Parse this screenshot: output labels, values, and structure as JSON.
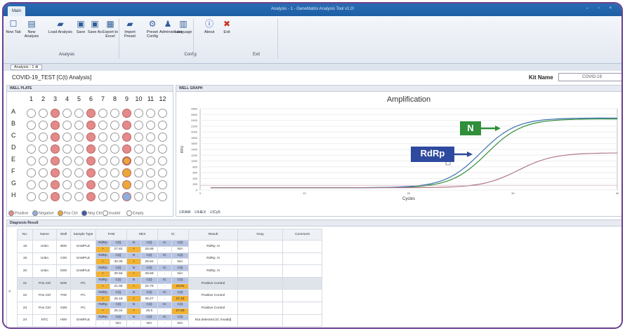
{
  "titlebar": {
    "tab": "Main",
    "title": "Analysis - 1 - GeneMatrix Analysis Tool v1.0!",
    "window_controls": "– ▫ ×"
  },
  "ribbon": {
    "buttons": [
      {
        "label": "New Tab",
        "icon": "new-tab-icon"
      },
      {
        "label": "New Analysis",
        "icon": "new-analysis-icon"
      },
      {
        "label": "Load Analysis",
        "icon": "folder-icon"
      },
      {
        "label": "Save",
        "icon": "save-icon"
      },
      {
        "label": "Save As",
        "icon": "save-as-icon"
      },
      {
        "label": "Export to Excel",
        "icon": "excel-icon"
      },
      {
        "label": "Import Preset",
        "icon": "import-icon"
      },
      {
        "label": "Preset Config",
        "icon": "gear-icon"
      },
      {
        "label": "Administrator",
        "icon": "admin-icon"
      },
      {
        "label": "Language",
        "icon": "language-icon"
      },
      {
        "label": "About",
        "icon": "info-icon"
      },
      {
        "label": "Exit",
        "icon": "exit-icon"
      }
    ],
    "groups": [
      "Analysis",
      "Config",
      "Exit"
    ]
  },
  "tabstrip": {
    "tab": "Analysis - 1 ⊗"
  },
  "header": {
    "test_name": "COVID-19_TEST [C(t) Analysis]",
    "kit_label": "Kit Name",
    "kit_value": "COVID-19"
  },
  "well_plate": {
    "title": "WELL PLATE",
    "cols": [
      "1",
      "2",
      "3",
      "4",
      "5",
      "6",
      "7",
      "8",
      "9",
      "10",
      "11",
      "12"
    ],
    "rows": [
      "A",
      "B",
      "C",
      "D",
      "E",
      "F",
      "G",
      "H"
    ],
    "legend": [
      "Positive",
      "Negative",
      "Pos Ctrl",
      "Neg Ctrl",
      "Invalid",
      "Empty"
    ]
  },
  "well_graph": {
    "title": "WELL GRAPH",
    "channels": [
      "FAM",
      "HEX",
      "Cy5"
    ]
  },
  "chart_data": {
    "type": "line",
    "title": "Amplification",
    "xlabel": "Cycles",
    "ylabel": "RFU",
    "xticks": [
      0,
      10,
      20,
      30,
      40
    ],
    "yticks": [
      0,
      200,
      400,
      600,
      800,
      1000,
      1200,
      1400,
      1600,
      1800,
      2000,
      2200,
      2400,
      2600,
      2800
    ],
    "xlim": [
      0,
      40
    ],
    "ylim": [
      0,
      2800
    ],
    "series": [
      {
        "name": "N",
        "color": "#2f8f3a",
        "ct": 27.5,
        "max": 2450
      },
      {
        "name": "RdRp",
        "color": "#3b6fb0",
        "ct": 26.9,
        "max": 2480
      },
      {
        "name": "",
        "color": "#b07a86",
        "ct": 30.5,
        "max": 1280
      }
    ],
    "annotations": [
      "N",
      "RdRp"
    ]
  },
  "diag": {
    "title": "Diagnosis Result",
    "headers": [
      "No.",
      "Name",
      "Well",
      "Sample Type",
      "FAM",
      "HEX",
      "IC",
      "Result",
      "Gray",
      "Comment"
    ],
    "rows": [
      {
        "no": "18",
        "name": "Unkn",
        "well": "B09",
        "type": "SAMPLE",
        "fam_t": "RdRp",
        "fam_ct": "27.82",
        "hex_t": "N",
        "hex_ct": "28.89",
        "ic_t": "IC",
        "ic_ct": "N/A",
        "result": "RdRp, N"
      },
      {
        "no": "19",
        "name": "Unkn",
        "well": "C09",
        "type": "SAMPLE",
        "fam_t": "RdRp",
        "fam_ct": "30.35",
        "hex_t": "N",
        "hex_ct": "29.92",
        "ic_t": "IC",
        "ic_ct": "N/A",
        "result": "RdRp, N"
      },
      {
        "no": "20",
        "name": "Unkn",
        "well": "D09",
        "type": "SAMPLE",
        "fam_t": "RdRp",
        "fam_ct": "30.55",
        "hex_t": "N",
        "hex_ct": "29.68",
        "ic_t": "IC",
        "ic_ct": "N/A",
        "result": "RdRp, N"
      },
      {
        "no": "21",
        "name": "Pos Ctrl",
        "well": "E09",
        "type": "PC",
        "fam_t": "RdRp",
        "fam_ct": "21.98",
        "hex_t": "N",
        "hex_ct": "22.76",
        "ic_t": "IC",
        "ic_ct": "23.81",
        "result": "Positive Control"
      },
      {
        "no": "22",
        "name": "Pos Ctrl",
        "well": "F09",
        "type": "PC",
        "fam_t": "RdRp",
        "fam_ct": "25.18",
        "hex_t": "N",
        "hex_ct": "26.27",
        "ic_t": "IC",
        "ic_ct": "27.44",
        "result": "Positive Control"
      },
      {
        "no": "23",
        "name": "Pos Ctrl",
        "well": "G09",
        "type": "PC",
        "fam_t": "RdRp",
        "fam_ct": "25.34",
        "hex_t": "N",
        "hex_ct": "26.5",
        "ic_t": "IC",
        "ic_ct": "27.68",
        "result": "Positive Control"
      },
      {
        "no": "24",
        "name": "NTC",
        "well": "H09",
        "type": "SAMPLE",
        "fam_t": "RdRp",
        "fam_ct": "N/A",
        "hex_t": "N",
        "hex_ct": "N/A",
        "ic_t": "IC",
        "ic_ct": "N/A",
        "result": "Not detected (IC Invalid)"
      }
    ]
  }
}
